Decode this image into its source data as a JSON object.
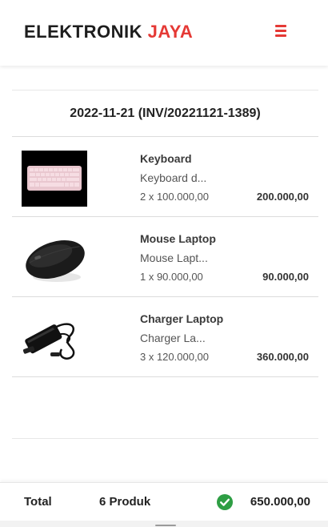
{
  "header": {
    "brand_main": "ELEKTRONIK",
    "brand_accent": "JAYA",
    "accent_color": "#e53935"
  },
  "invoice": {
    "title": "2022-11-21 (INV/20221121-1389)"
  },
  "items": [
    {
      "name": "Keyboard",
      "desc": "Keyboard d...",
      "qty": "2 x 100.000,00",
      "subtotal": "200.000,00",
      "image": "keyboard-image"
    },
    {
      "name": "Mouse Laptop",
      "desc": "Mouse Lapt...",
      "qty": "1 x 90.000,00",
      "subtotal": "90.000,00",
      "image": "mouse-image"
    },
    {
      "name": "Charger Laptop",
      "desc": "Charger La...",
      "qty": "3 x 120.000,00",
      "subtotal": "360.000,00",
      "image": "charger-image"
    }
  ],
  "footer": {
    "label": "Total",
    "count": "6 Produk",
    "total": "650.000,00",
    "status_icon": "check-circle-icon",
    "status_color": "#2e9e44"
  }
}
